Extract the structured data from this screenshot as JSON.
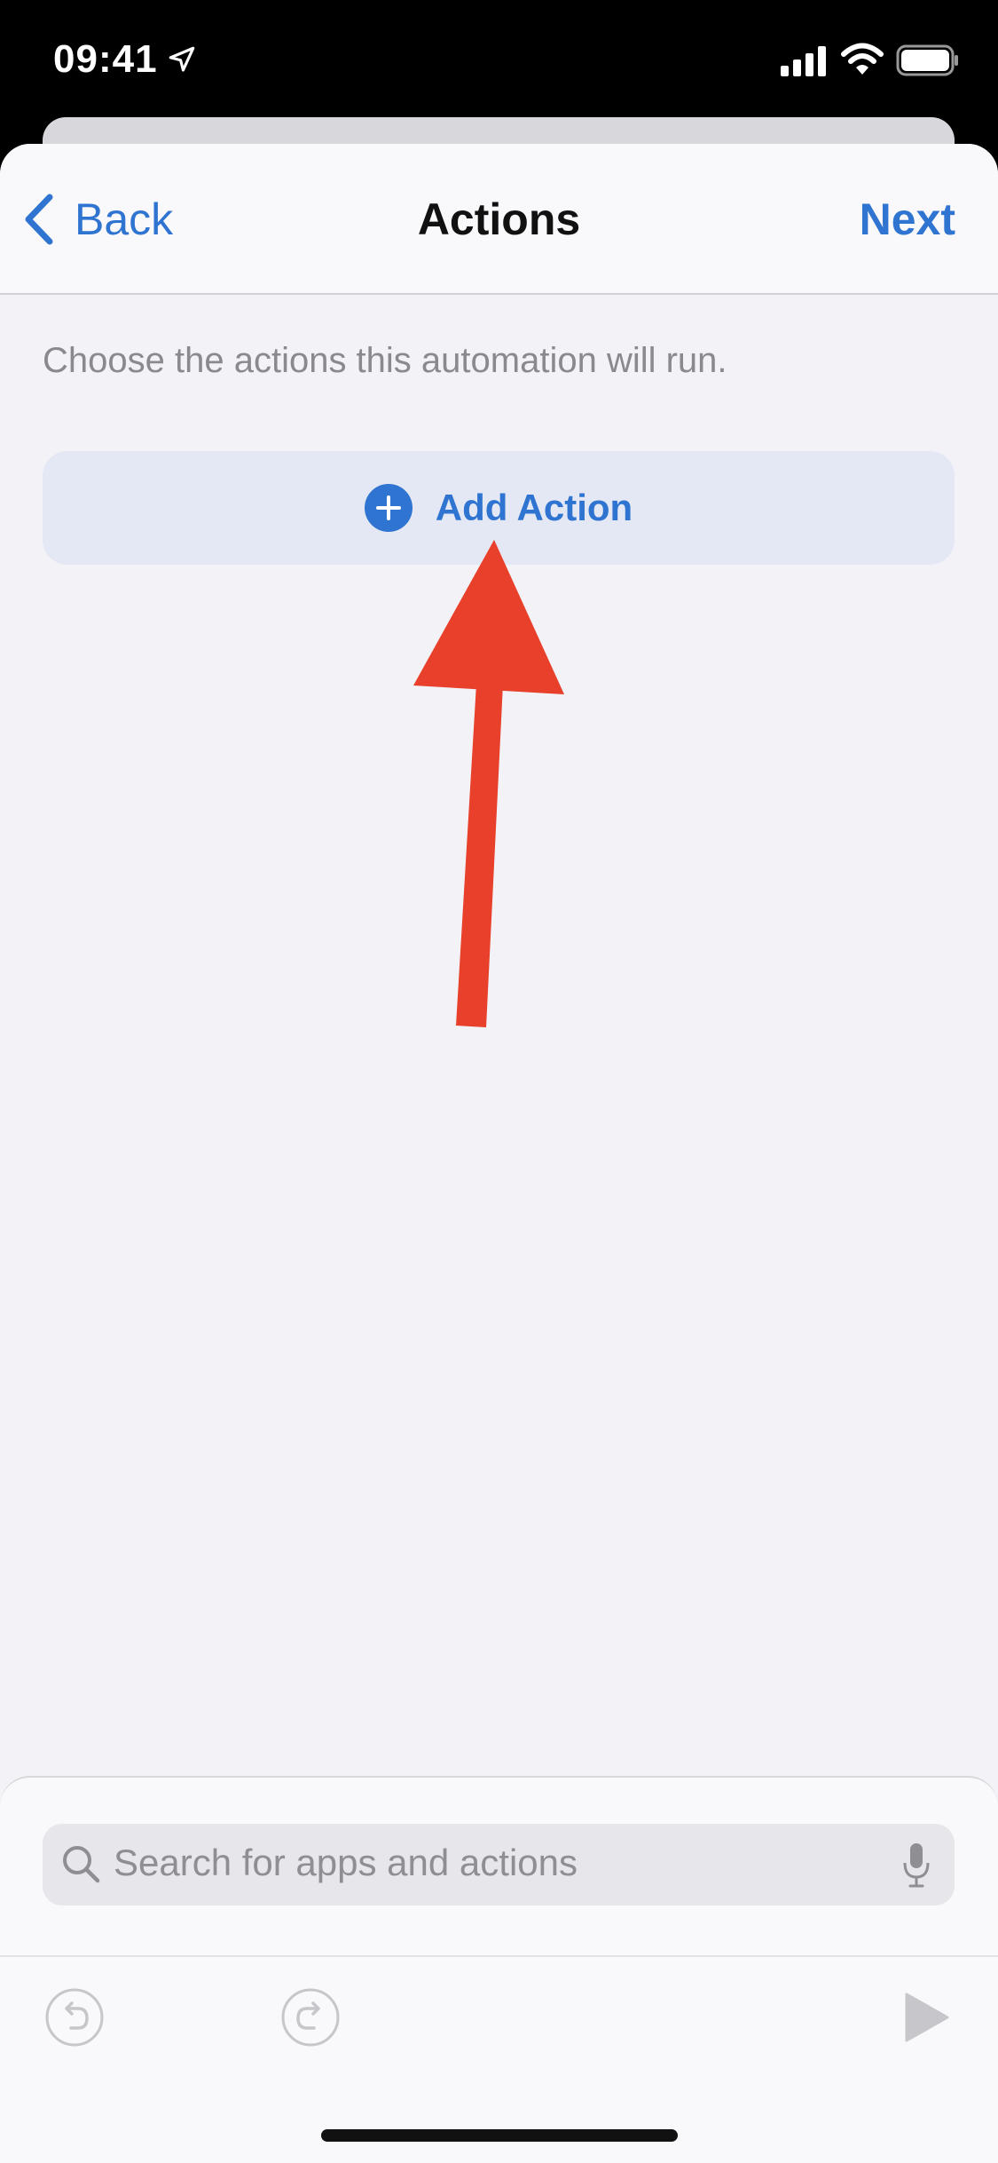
{
  "status_bar": {
    "time": "09:41",
    "icons": [
      "location-arrow-icon",
      "cellular-signal-icon",
      "wifi-icon",
      "battery-icon"
    ]
  },
  "nav": {
    "back_label": "Back",
    "title": "Actions",
    "next_label": "Next"
  },
  "content": {
    "subtitle": "Choose the actions this automation will run.",
    "add_action_label": "Add Action"
  },
  "search": {
    "placeholder": "Search for apps and actions"
  },
  "toolbar": {
    "icons": [
      "undo-icon",
      "redo-icon",
      "play-icon"
    ]
  },
  "colors": {
    "accent": "#2f74d0",
    "annotation_arrow": "#e8402a",
    "background": "#f2f2f7"
  }
}
